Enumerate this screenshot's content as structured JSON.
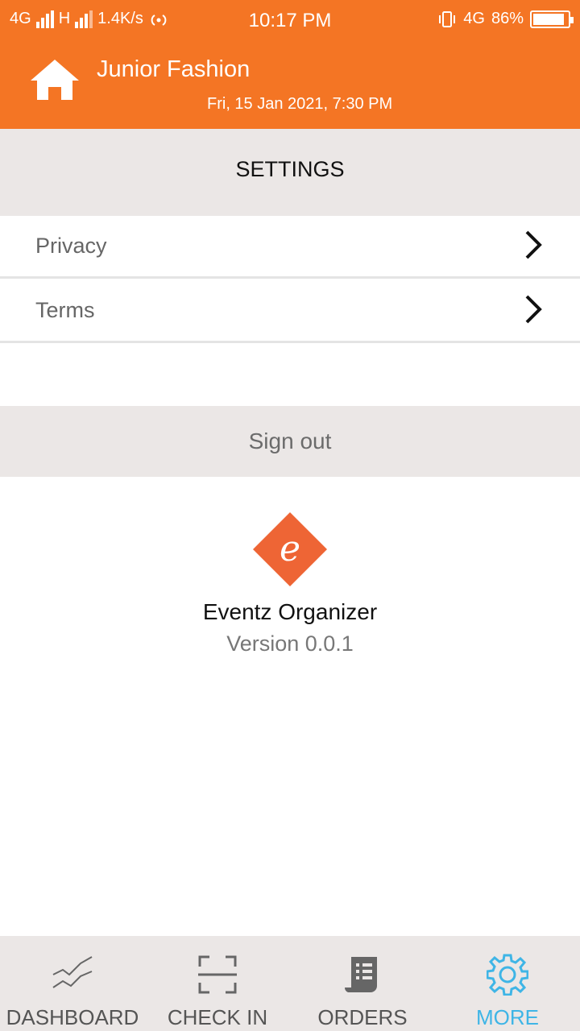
{
  "status_bar": {
    "network_1": "4G",
    "network_2": "H",
    "speed": "1.4K/s",
    "time": "10:17 PM",
    "network_3": "4G",
    "battery": "86%"
  },
  "header": {
    "title": "Junior Fashion",
    "date": "Fri, 15 Jan 2021, 7:30 PM",
    "home_icon": "home-icon"
  },
  "settings": {
    "title": "SETTINGS",
    "items": [
      {
        "label": "Privacy"
      },
      {
        "label": "Terms"
      }
    ],
    "sign_out": "Sign out"
  },
  "app_info": {
    "logo_letter": "e",
    "name": "Eventz Organizer",
    "version": "Version 0.0.1"
  },
  "tabbar": {
    "tabs": [
      {
        "label": "DASHBOARD",
        "icon": "chart-icon"
      },
      {
        "label": "CHECK IN",
        "icon": "scan-icon"
      },
      {
        "label": "ORDERS",
        "icon": "receipt-icon"
      },
      {
        "label": "MORE",
        "icon": "gear-icon"
      }
    ],
    "active_color": "#3fb5e6"
  },
  "colors": {
    "brand_orange": "#f47524",
    "band_gray": "#ebe7e6",
    "logo_orange": "#ee6535"
  }
}
